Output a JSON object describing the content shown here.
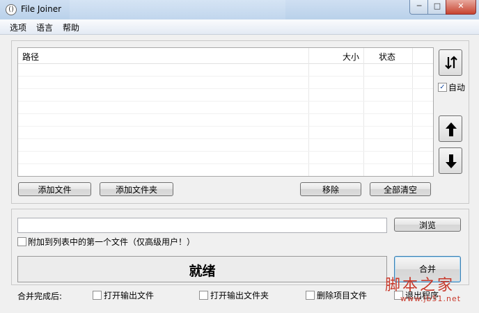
{
  "window": {
    "title": "File Joiner",
    "controls": {
      "minimize": "─",
      "maximize": "□",
      "close": "✕"
    }
  },
  "menu": [
    "选项",
    "语言",
    "帮助"
  ],
  "file_list": {
    "columns": [
      "路径",
      "大小",
      "状态"
    ],
    "rows": []
  },
  "side": {
    "sort_icon": "sort-updown-icon",
    "auto_label": "自动",
    "auto_checked": true,
    "up_icon": "arrow-up-icon",
    "down_icon": "arrow-down-icon"
  },
  "list_buttons": {
    "add_file": "添加文件",
    "add_folder": "添加文件夹",
    "remove": "移除",
    "clear_all": "全部清空"
  },
  "output": {
    "path_value": "",
    "browse": "浏览",
    "append_first_label": "附加到列表中的第一个文件（仅高级用户！）",
    "append_first_checked": false
  },
  "status": {
    "text": "就绪",
    "merge": "合并"
  },
  "after_merge": {
    "label": "合并完成后:",
    "open_file": "打开输出文件",
    "open_folder": "打开输出文件夹",
    "delete_items": "删除项目文件",
    "exit_program": "退出程序"
  },
  "watermark": {
    "logo": "脚本之家",
    "url": "www.jb51.net"
  }
}
